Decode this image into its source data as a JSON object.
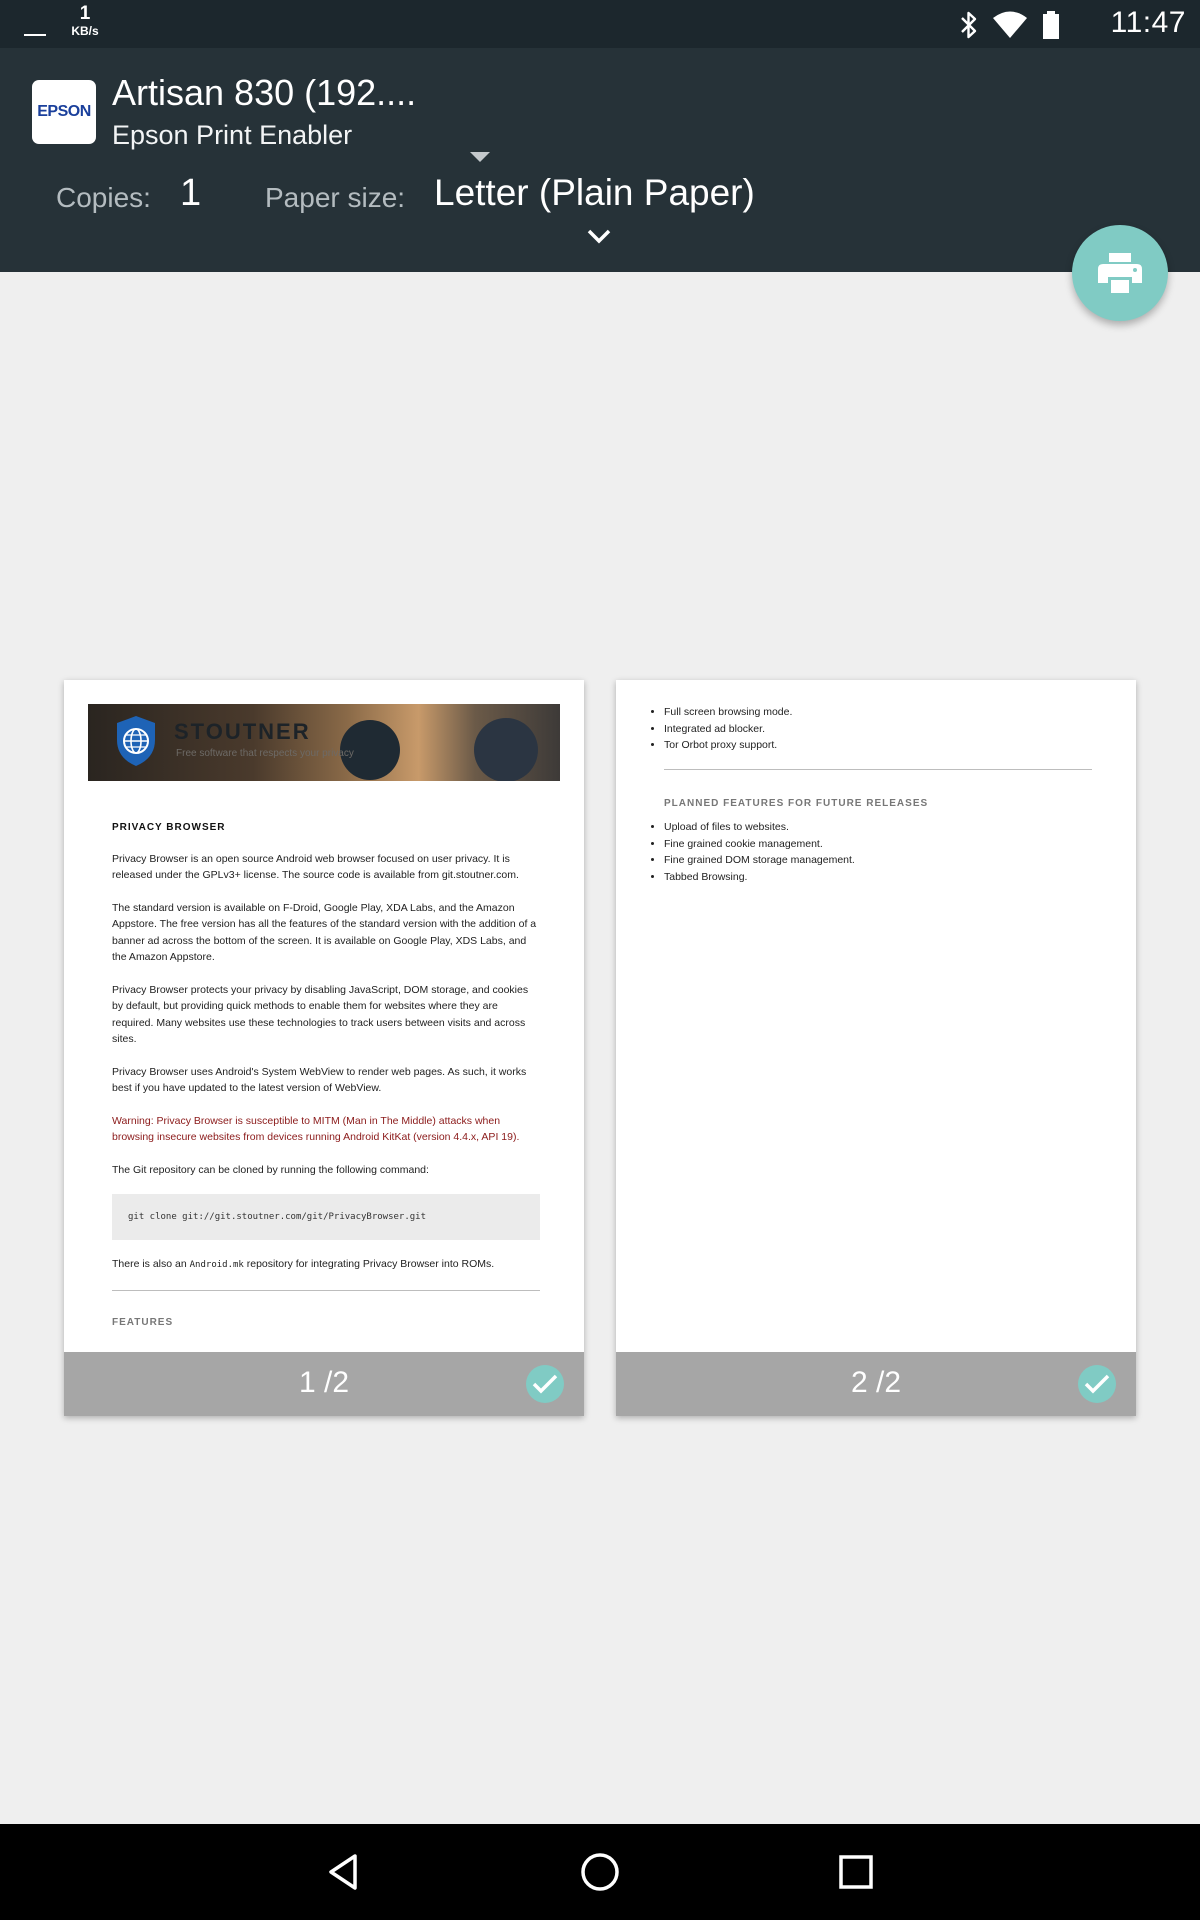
{
  "status_bar": {
    "speed_value": "1",
    "speed_unit": "KB/s",
    "time": "11:47",
    "icons": [
      "bluetooth-icon",
      "wifi-icon",
      "battery-icon"
    ]
  },
  "header": {
    "logo_text": "EPSON",
    "printer_name": "Artisan 830 (192....",
    "service_name": "Epson Print Enabler",
    "copies_label": "Copies:",
    "copies_value": "1",
    "paper_size_label": "Paper size:",
    "paper_size_value": "Letter (Plain Paper)"
  },
  "colors": {
    "status_bar": "#1c272d",
    "header": "#263238",
    "accent": "#80cbc4",
    "page_footer": "#a6a6a6",
    "background": "#efefef"
  },
  "pages": [
    {
      "label": "1 /2",
      "selected": true,
      "banner_title": "STOUTNER",
      "banner_tagline": "Free software that respects your privacy",
      "heading": "PRIVACY BROWSER",
      "para1": "Privacy Browser is an open source Android web browser focused on user privacy. It is released under the GPLv3+ license. The source code is available from git.stoutner.com.",
      "para2": "The standard version is available on F-Droid, Google Play, XDA Labs, and the Amazon Appstore. The free version has all the features of the standard version with the addition of a banner ad across the bottom of the screen. It is available on Google Play, XDS Labs, and the Amazon Appstore.",
      "para3": "Privacy Browser protects your privacy by disabling JavaScript, DOM storage, and cookies by default, but providing quick methods to enable them for websites where they are required. Many websites use these technologies to track users between visits and across sites.",
      "para4": "Privacy Browser uses Android's System WebView to render web pages. As such, it works best if you have updated to the latest version of WebView.",
      "warning": "Warning: Privacy Browser is susceptible to MITM (Man in The Middle) attacks when browsing insecure websites from devices running Android KitKat (version 4.4.x, API 19).",
      "git_intro": "The Git repository can be cloned by running the following command:",
      "git_command": "git clone git://git.stoutner.com/git/PrivacyBrowser.git",
      "android_mk_prefix": "There is also an",
      "android_mk_code": "Android.mk",
      "android_mk_suffix": "repository for integrating Privacy Browser into ROMs.",
      "features_heading": "FEATURES"
    },
    {
      "label": "2 /2",
      "selected": true,
      "features": [
        "Full screen browsing mode.",
        "Integrated ad blocker.",
        "Tor Orbot proxy support."
      ],
      "planned_heading": "PLANNED FEATURES FOR FUTURE RELEASES",
      "planned": [
        "Upload of files to websites.",
        "Fine grained cookie management.",
        "Fine grained DOM storage management.",
        "Tabbed Browsing."
      ]
    }
  ],
  "nav_bar": {
    "buttons": [
      "back-icon",
      "home-icon",
      "recents-icon"
    ]
  }
}
